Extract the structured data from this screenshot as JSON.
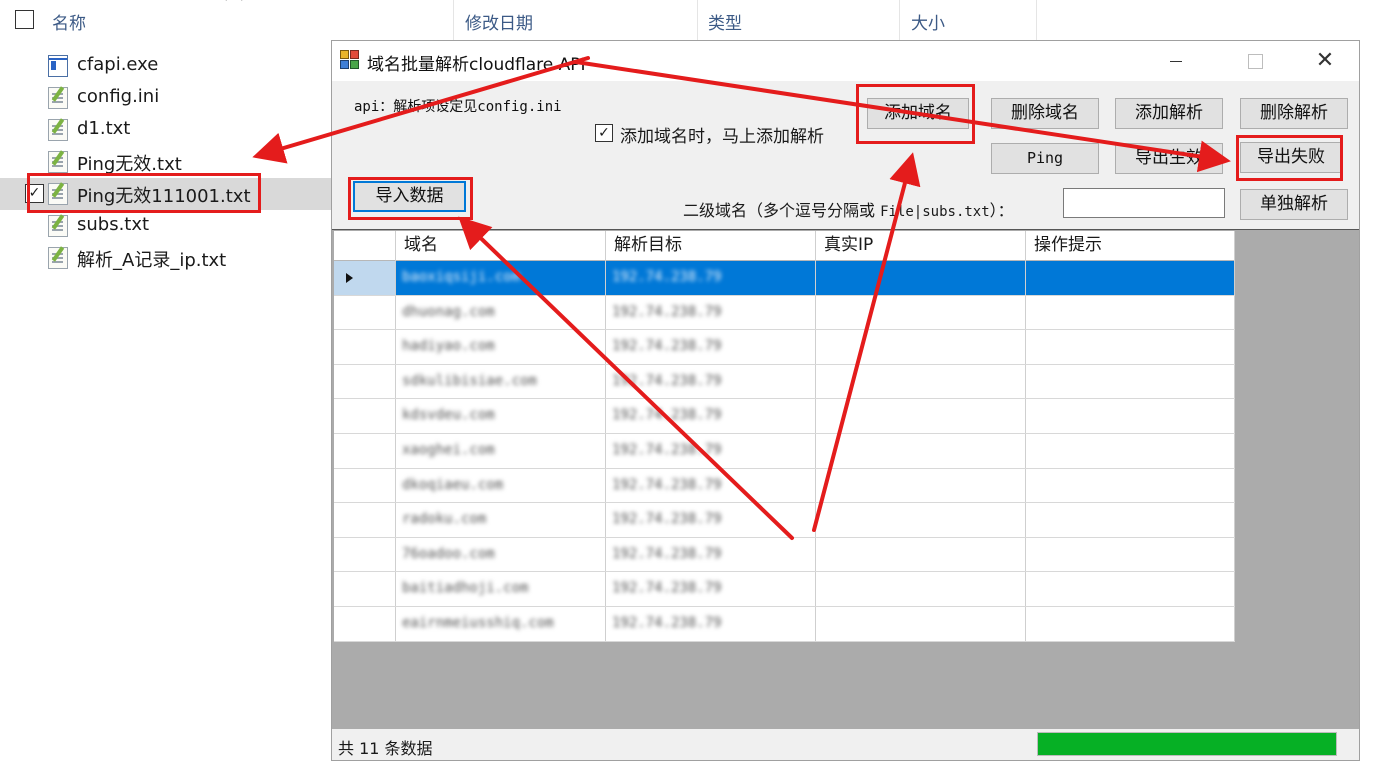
{
  "explorer": {
    "columns": [
      "名称",
      "修改日期",
      "类型",
      "大小"
    ],
    "files": [
      {
        "name": "cfapi.exe",
        "icon": "exe-icon"
      },
      {
        "name": "config.ini",
        "icon": "text-file-icon"
      },
      {
        "name": "d1.txt",
        "icon": "text-file-icon"
      },
      {
        "name": "Ping无效.txt",
        "icon": "text-file-icon"
      },
      {
        "name": "Ping无效111001.txt",
        "icon": "text-file-icon",
        "selected": true
      },
      {
        "name": "subs.txt",
        "icon": "text-file-icon"
      },
      {
        "name": "解析_A记录_ip.txt",
        "icon": "text-file-icon"
      }
    ]
  },
  "app": {
    "title": "域名批量解析cloudflare API",
    "api_note": "api：解析项设定见config.ini",
    "checkbox": {
      "label": "添加域名时，马上添加解析",
      "checked": true,
      "mark": "✓"
    },
    "buttons": {
      "import": "导入数据",
      "add_domain": "添加域名",
      "delete_domain": "删除域名",
      "add_record": "添加解析",
      "delete_record": "删除解析",
      "ping": "Ping",
      "export_ok": "导出生效",
      "export_fail": "导出失败",
      "single_resolve": "单独解析"
    },
    "subdomain": {
      "label_prefix": "二级域名（多个逗号分隔或 ",
      "label_mono": "File|subs.txt",
      "label_suffix": "）：",
      "value": ""
    },
    "grid": {
      "headers": [
        "域名",
        "解析目标",
        "真实IP",
        "操作提示"
      ],
      "rows": [
        {
          "domain": "baoxiqsiji.com",
          "target": "192.74.238.79",
          "ip": "",
          "tip": ""
        },
        {
          "domain": "dhuonag.com",
          "target": "192.74.238.79",
          "ip": "",
          "tip": ""
        },
        {
          "domain": "hadiyao.com",
          "target": "192.74.238.79",
          "ip": "",
          "tip": ""
        },
        {
          "domain": "sdkulibisiae.com",
          "target": "192.74.238.79",
          "ip": "",
          "tip": ""
        },
        {
          "domain": "kdsvdeu.com",
          "target": "192.74.238.79",
          "ip": "",
          "tip": ""
        },
        {
          "domain": "xaoghei.com",
          "target": "192.74.238.79",
          "ip": "",
          "tip": ""
        },
        {
          "domain": "dkoqiaeu.com",
          "target": "192.74.238.79",
          "ip": "",
          "tip": ""
        },
        {
          "domain": "radoku.com",
          "target": "192.74.238.79",
          "ip": "",
          "tip": ""
        },
        {
          "domain": "76oadoo.com",
          "target": "192.74.238.79",
          "ip": "",
          "tip": ""
        },
        {
          "domain": "baitiadhoji.com",
          "target": "192.74.238.79",
          "ip": "",
          "tip": ""
        },
        {
          "domain": "eairnmeiusshiq.com",
          "target": "192.74.238.79",
          "ip": "",
          "tip": ""
        }
      ]
    },
    "status": {
      "text": "共 11 条数据",
      "progress": 1.0
    }
  },
  "colors": {
    "selection": "#0078d7",
    "annotation": "#e41c1c",
    "progress": "#06b025"
  }
}
